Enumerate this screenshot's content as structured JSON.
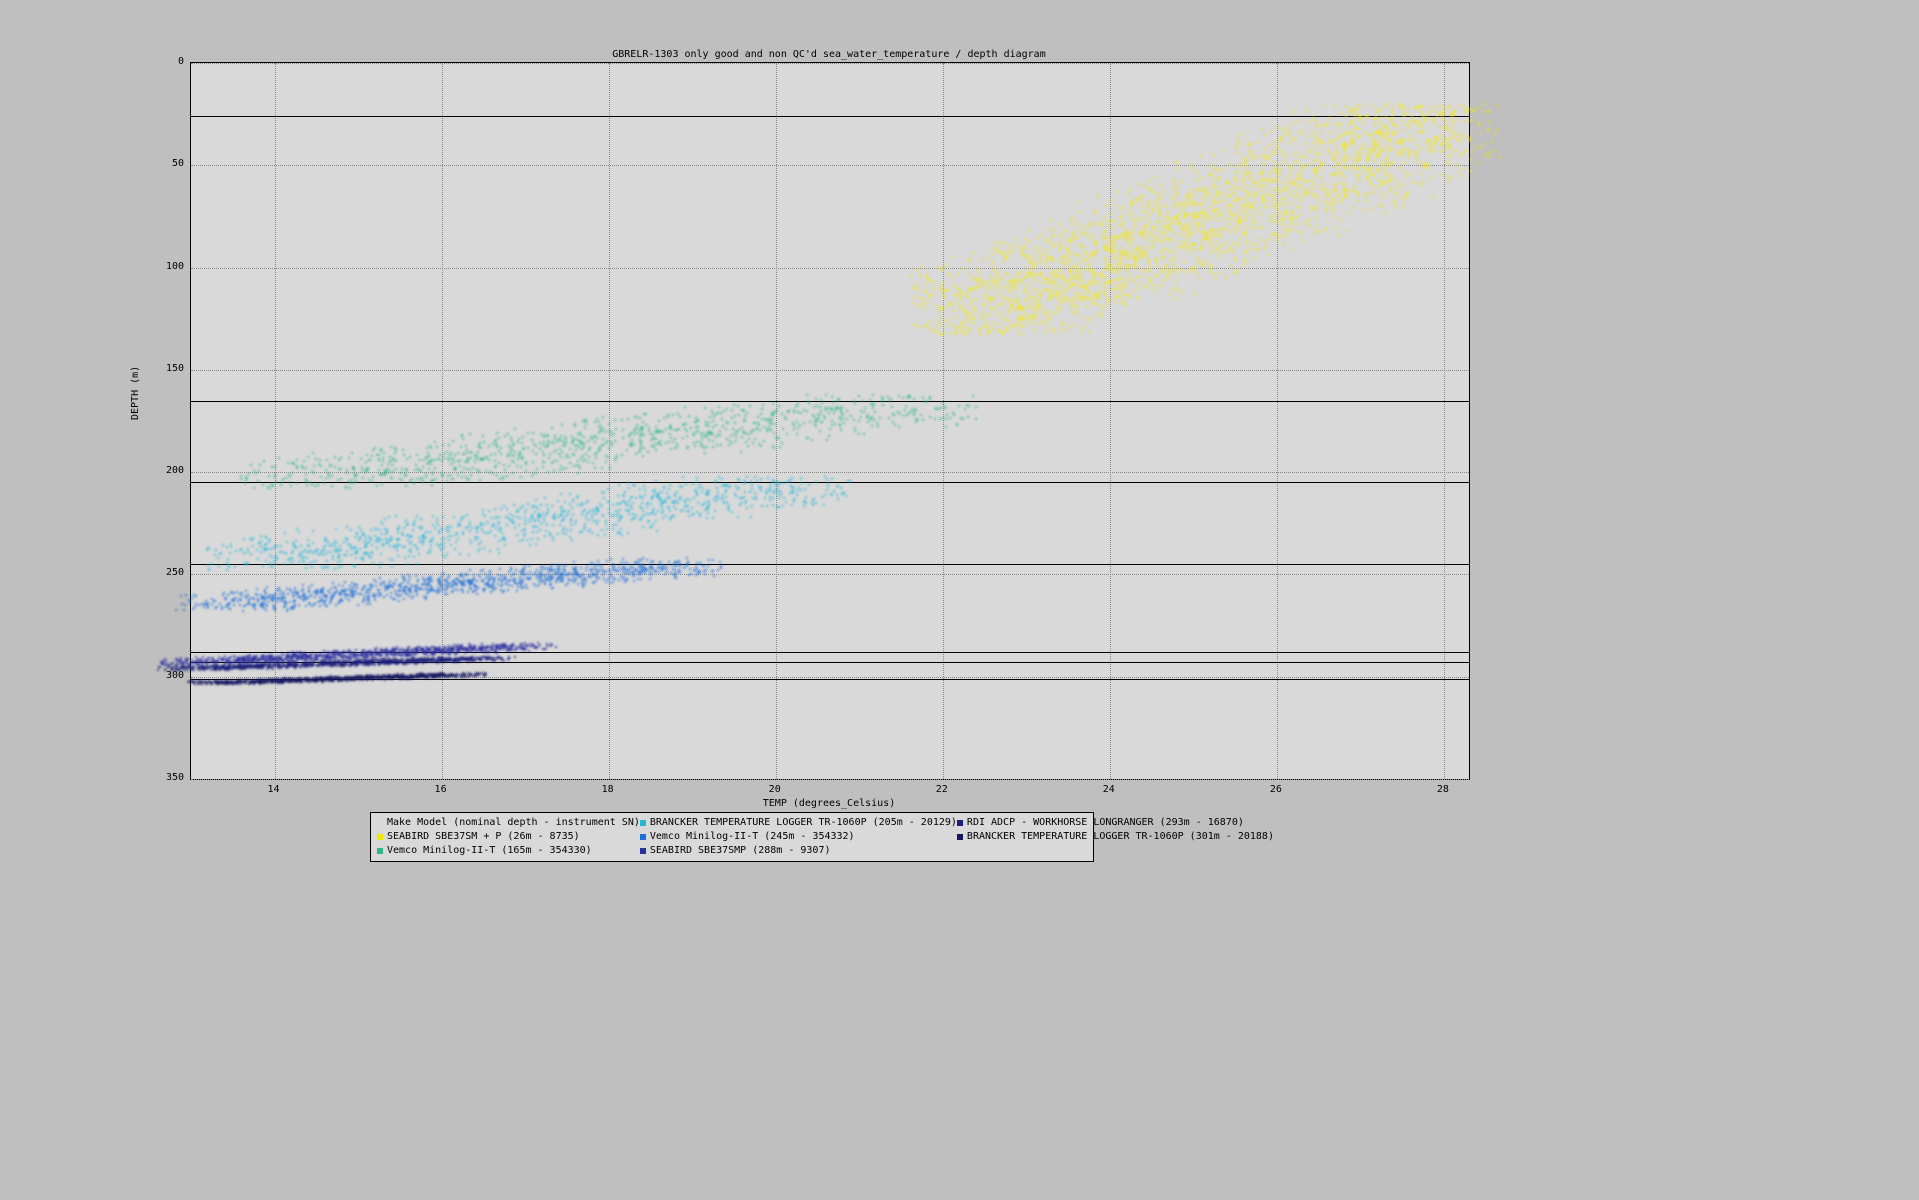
{
  "chart_data": {
    "type": "scatter",
    "title": "GBRELR-1303 only good and non QC'd sea_water_temperature / depth diagram",
    "xlabel": "TEMP (degrees_Celsius)",
    "ylabel": "DEPTH (m)",
    "xlim": [
      13,
      28.3
    ],
    "ylim": [
      0,
      350
    ],
    "y_reversed": true,
    "xticks": [
      14,
      16,
      18,
      20,
      22,
      24,
      26,
      28
    ],
    "yticks": [
      0,
      50,
      100,
      150,
      200,
      250,
      300,
      350
    ],
    "hlines_depth": [
      26,
      165,
      205,
      245,
      288,
      293,
      301
    ],
    "legend_title": "Make Model (nominal depth - instrument SN)",
    "series": [
      {
        "name": "SEABIRD SBE37SM + P (26m - 8735)",
        "color": "#F2E900",
        "temp_range": [
          22.0,
          28.3
        ],
        "depth_range": [
          23,
          130
        ]
      },
      {
        "name": "Vemco Minilog-II-T (165m - 354330)",
        "color": "#31B58B",
        "temp_range": [
          14.0,
          22.0
        ],
        "depth_range": [
          165,
          205
        ]
      },
      {
        "name": "BRANCKER TEMPERATURE LOGGER TR-1060P (205m - 20129)",
        "color": "#26B7D7",
        "temp_range": [
          13.5,
          20.5
        ],
        "depth_range": [
          205,
          245
        ]
      },
      {
        "name": "Vemco Minilog-II-T (245m - 354332)",
        "color": "#1F6FD6",
        "temp_range": [
          13.2,
          19.0
        ],
        "depth_range": [
          245,
          265
        ]
      },
      {
        "name": "SEABIRD SBE37SMP (288m - 9307)",
        "color": "#2C2F9E",
        "temp_range": [
          13.0,
          17.0
        ],
        "depth_range": [
          285,
          293
        ]
      },
      {
        "name": "RDI ADCP - WORKHORSE LONGRANGER (293m - 16870)",
        "color": "#1C1F7A",
        "temp_range": [
          13.0,
          16.5
        ],
        "depth_range": [
          291,
          296
        ]
      },
      {
        "name": "BRANCKER TEMPERATURE LOGGER TR-1060P (301m - 20188)",
        "color": "#151860",
        "temp_range": [
          13.3,
          16.2
        ],
        "depth_range": [
          299,
          303
        ]
      }
    ]
  }
}
